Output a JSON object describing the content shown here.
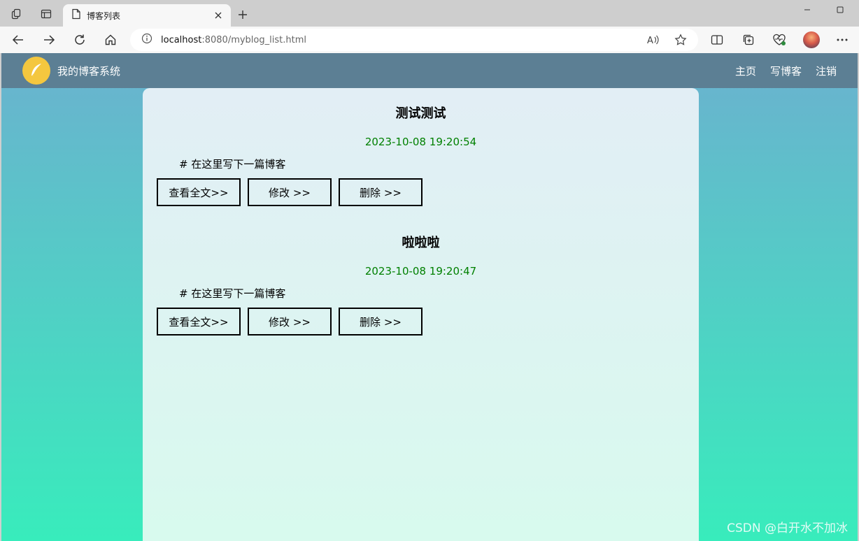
{
  "browser": {
    "tab_title": "博客列表",
    "url_host": "localhost",
    "url_rest": ":8080/myblog_list.html",
    "accent": "#f7f7f7"
  },
  "site": {
    "title": "我的博客系统",
    "nav": [
      "主页",
      "写博客",
      "注销"
    ],
    "logo_icon": "feather-icon",
    "nav_color": "#5c7f94"
  },
  "blogs": [
    {
      "title": "测试测试",
      "date": "2023-10-08 19:20:54",
      "desc": "# 在这里写下一篇博客",
      "btn_view": "查看全文>>",
      "btn_edit": "修改 >>",
      "btn_delete": "删除 >>"
    },
    {
      "title": "啦啦啦",
      "date": "2023-10-08 19:20:47",
      "desc": "# 在这里写下一篇博客",
      "btn_view": "查看全文>>",
      "btn_edit": "修改 >>",
      "btn_delete": "删除 >>"
    }
  ],
  "watermark": "CSDN @白开水不加冰",
  "colors": {
    "date": "#008000",
    "bg_top": "#6bb1cf",
    "bg_bottom": "#38ecbc"
  }
}
